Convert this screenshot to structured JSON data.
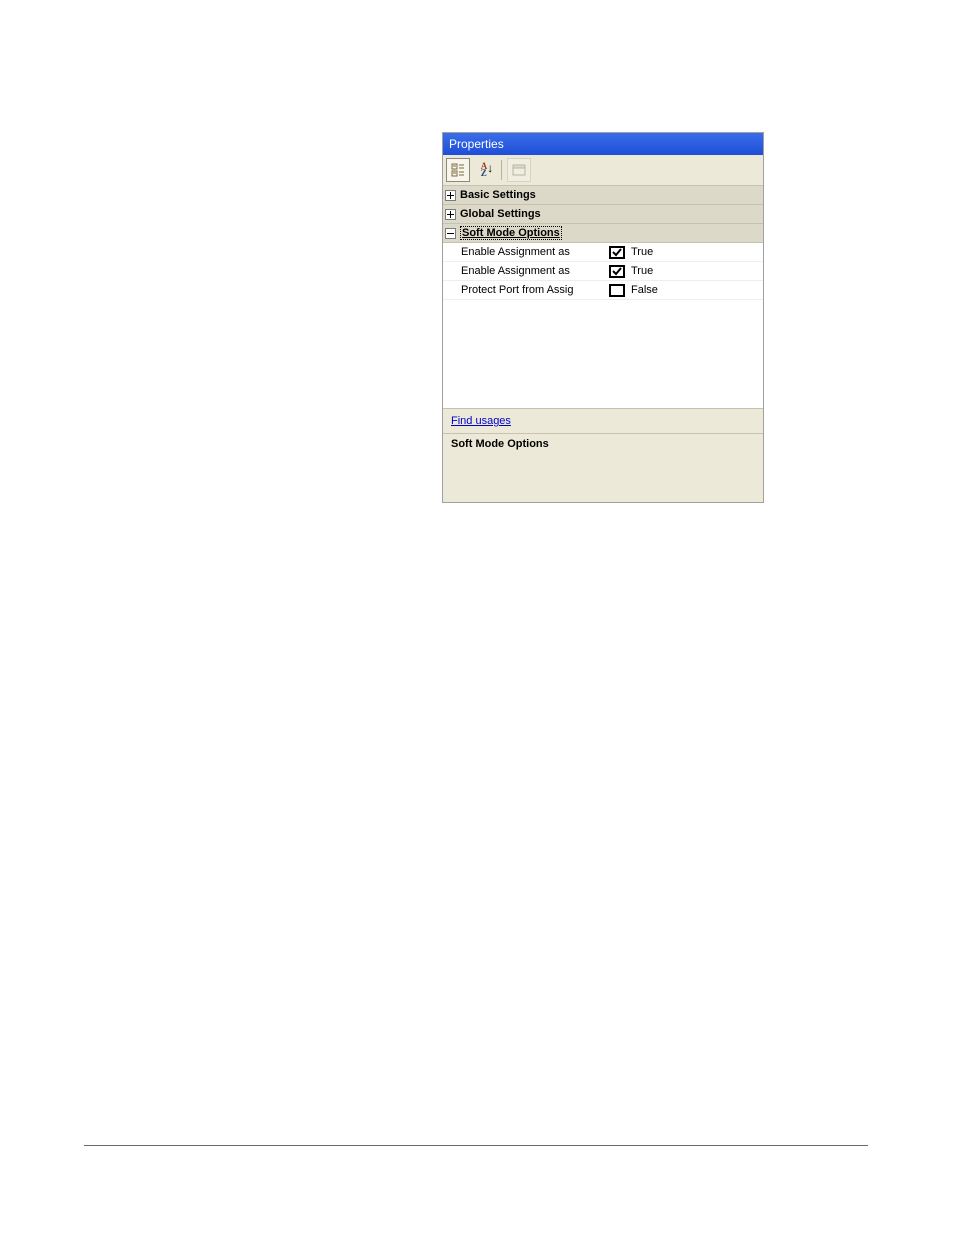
{
  "panel": {
    "title": "Properties",
    "categories": [
      {
        "label": "Basic Settings",
        "expanded": false
      },
      {
        "label": "Global Settings",
        "expanded": false
      },
      {
        "label": "Soft Mode Options",
        "expanded": true,
        "selected": true
      }
    ],
    "properties": [
      {
        "name": "Enable Assignment as",
        "checked": true,
        "value": "True"
      },
      {
        "name": "Enable Assignment as",
        "checked": true,
        "value": "True"
      },
      {
        "name": "Protect Port from Assig",
        "checked": false,
        "value": "False"
      }
    ],
    "link": "Find usages",
    "description_title": "Soft Mode Options"
  }
}
